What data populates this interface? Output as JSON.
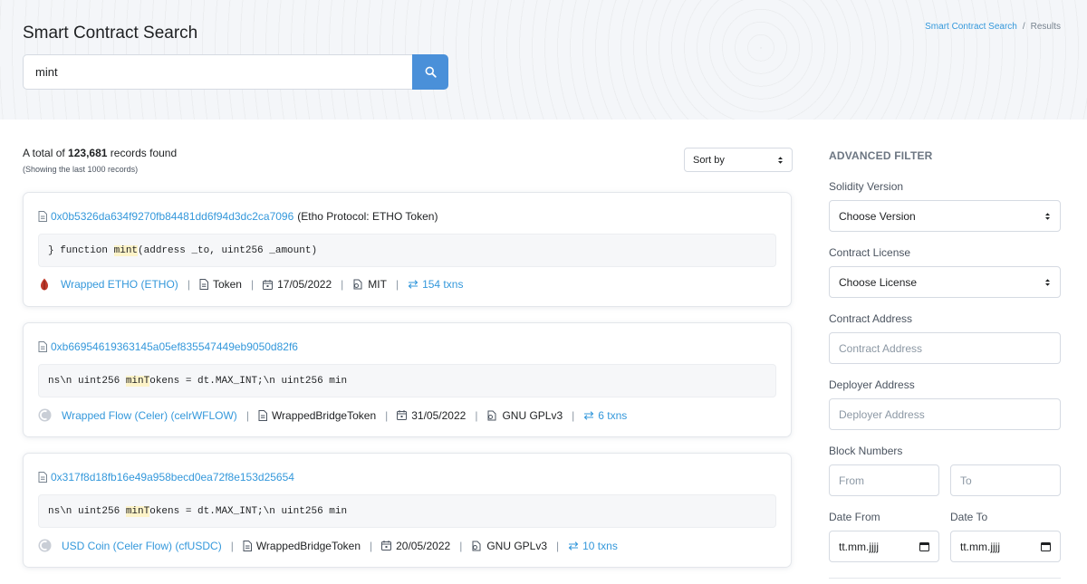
{
  "header": {
    "title": "Smart Contract Search",
    "breadcrumb": {
      "link": "Smart Contract Search",
      "separator": "/",
      "current": "Results"
    },
    "search": {
      "value": "mint",
      "button_icon": "search-icon"
    }
  },
  "summary": {
    "prefix": "A total of",
    "count": "123,681",
    "suffix": "records found",
    "note": "(Showing the last 1000 records)",
    "sort_label": "Sort by"
  },
  "results": [
    {
      "address": "0x0b5326da634f9270fb84481dd6f94d3dc2ca7096",
      "contract_name": "(Etho Protocol: ETHO Token)",
      "code_before": "} function ",
      "code_highlight": "mint",
      "code_after": "(address _to, uint256 _amount)",
      "token": "Wrapped ETHO (ETHO)",
      "token_icon": "etho-logo-icon",
      "type": "Token",
      "date": "17/05/2022",
      "license": "MIT",
      "txns": "154 txns"
    },
    {
      "address": "0xb66954619363145a05ef835547449eb9050d82f6",
      "contract_name": "",
      "code_before": "ns\\n uint256 ",
      "code_highlight": "minT",
      "code_after": "okens = dt.MAX_INT;\\n uint256 min",
      "token": "Wrapped Flow (Celer) (celrWFLOW)",
      "token_icon": "celer-logo-icon",
      "type": "WrappedBridgeToken",
      "date": "31/05/2022",
      "license": "GNU GPLv3",
      "txns": "6 txns"
    },
    {
      "address": "0x317f8d18fb16e49a958becd0ea72f8e153d25654",
      "contract_name": "",
      "code_before": "ns\\n uint256 ",
      "code_highlight": "minT",
      "code_after": "okens = dt.MAX_INT;\\n uint256 min",
      "token": "USD Coin (Celer Flow) (cfUSDC)",
      "token_icon": "celer-logo-icon",
      "type": "WrappedBridgeToken",
      "date": "20/05/2022",
      "license": "GNU GPLv3",
      "txns": "10 txns"
    }
  ],
  "filter": {
    "title": "ADVANCED FILTER",
    "solidity_label": "Solidity Version",
    "solidity_value": "Choose Version",
    "license_label": "Contract License",
    "license_value": "Choose License",
    "contract_address_label": "Contract Address",
    "contract_address_placeholder": "Contract Address",
    "deployer_address_label": "Deployer Address",
    "deployer_address_placeholder": "Deployer Address",
    "block_numbers_label": "Block Numbers",
    "block_from_placeholder": "From",
    "block_to_placeholder": "To",
    "date_from_label": "Date From",
    "date_to_label": "Date To",
    "date_from_value": "tt.mm.jjjj",
    "date_to_value": "tt.mm.jjjj"
  },
  "colors": {
    "accent": "#3498db",
    "search_button": "#4a90d9",
    "highlight": "#fdf3c8"
  }
}
